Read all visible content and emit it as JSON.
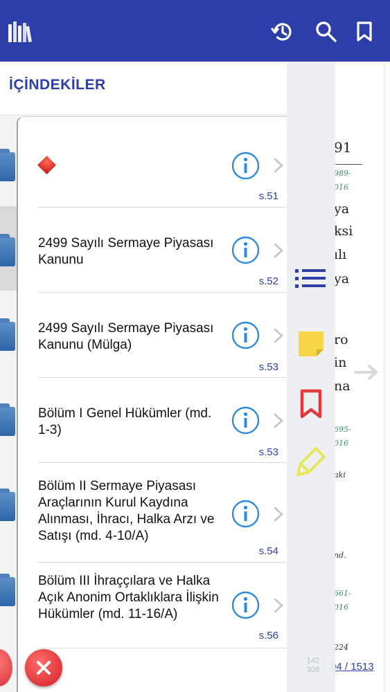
{
  "toc": {
    "title": "İÇİNDEKİLER",
    "rows": [
      {
        "label": "",
        "page": "s.51"
      },
      {
        "label": "2499 Sayılı Sermaye Piyasası Kanunu",
        "page": "s.52"
      },
      {
        "label": "2499 Sayılı Sermaye Piyasası Kanunu (Mülga)",
        "page": "s.53"
      },
      {
        "label": "Bölüm I Genel Hükümler (md. 1-3)",
        "page": "s.53"
      },
      {
        "label": "Bölüm II  Sermaye Piyasası Araçlarının Kurul Kaydına Alınması, İhracı, Halka Arzı ve Satışı  (md. 4-10/A)",
        "page": "s.54"
      },
      {
        "label": "Bölüm III  İhraççılara ve Halka Açık Anonim Ortaklıklara İlişkin Hükümler  (md. 11-16/A)",
        "page": "s.56"
      }
    ]
  },
  "document": {
    "lines": [
      {
        "text": "91",
        "kind": "text"
      },
      {
        "text": "989-",
        "kind": "note"
      },
      {
        "text": "016",
        "kind": "note"
      },
      {
        "text": "ya",
        "kind": "text"
      },
      {
        "text": "ksi",
        "kind": "text"
      },
      {
        "text": "ılı",
        "kind": "text"
      },
      {
        "text": "ya",
        "kind": "text"
      },
      {
        "text": "ro",
        "kind": "text"
      },
      {
        "text": "in",
        "kind": "text"
      },
      {
        "text": "na",
        "kind": "text"
      },
      {
        "text": "695-",
        "kind": "note"
      },
      {
        "text": "016",
        "kind": "note"
      },
      {
        "text": "aki",
        "kind": "dark"
      },
      {
        "text": "nd.",
        "kind": "dark"
      },
      {
        "text": "661-",
        "kind": "note"
      },
      {
        "text": "016",
        "kind": "note"
      },
      {
        "text": "224",
        "kind": "dark"
      }
    ],
    "page_current": "04",
    "page_total": "1513",
    "page_sep": " / "
  },
  "sidebar": {
    "small_top": "142",
    "small_bottom": "308"
  },
  "icons": {
    "logo": "books-logo-icon",
    "history": "history-icon",
    "search": "search-icon",
    "bookmark": "bookmark-icon",
    "list": "list-icon",
    "note": "sticky-note-icon",
    "bookmark_red": "bookmark-outline-icon",
    "highlighter": "highlighter-icon",
    "info": "info-icon",
    "chevron": "chevron-right-icon",
    "close": "close-icon"
  },
  "colors": {
    "primary": "#2d3ea8",
    "info": "#2b8be0",
    "danger": "#e23a3a",
    "note": "#f5d547",
    "highlight": "#e7e75a"
  }
}
